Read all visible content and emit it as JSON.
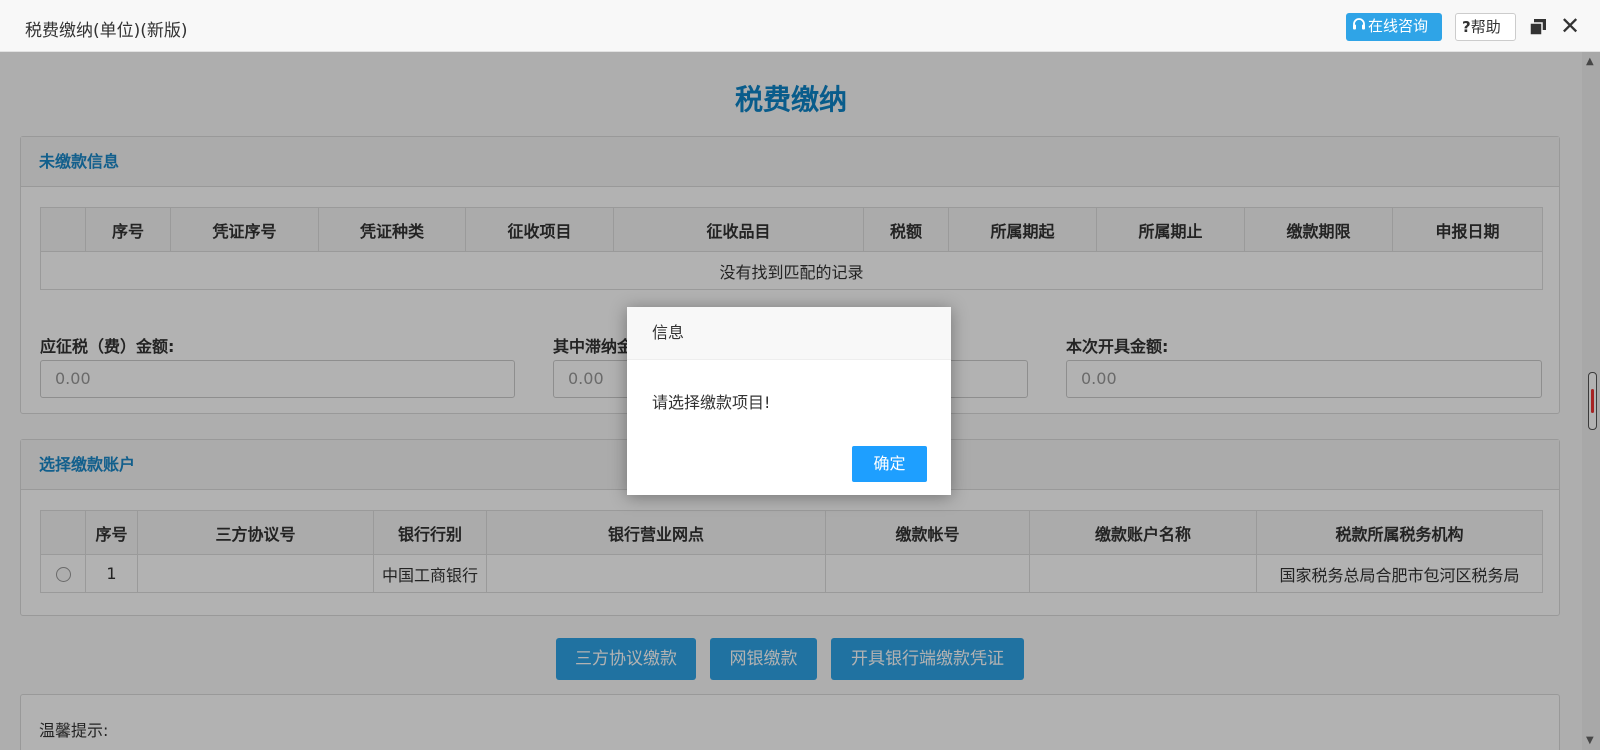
{
  "window": {
    "title": "税费缴纳(单位)(新版)",
    "online_consult": "在线咨询",
    "help": "帮助"
  },
  "page": {
    "title": "税费缴纳"
  },
  "unpaid": {
    "header": "未缴款信息",
    "columns": [
      "序号",
      "凭证序号",
      "凭证种类",
      "征收项目",
      "征收品目",
      "税额",
      "所属期起",
      "所属期止",
      "缴款期限",
      "申报日期"
    ],
    "empty_text": "没有找到匹配的记录"
  },
  "amounts": {
    "due_label": "应征税（费）金额:",
    "due_value": "0.00",
    "late_label": "其中滞纳金",
    "late_value": "0.00",
    "invoice_label": "本次开具金额:",
    "invoice_value": "0.00"
  },
  "account": {
    "header": "选择缴款账户",
    "columns": [
      "序号",
      "三方协议号",
      "银行行别",
      "银行营业网点",
      "缴款帐号",
      "缴款账户名称",
      "税款所属税务机构"
    ],
    "rows": [
      {
        "no": "1",
        "bank": "中国工商银行",
        "tax_office": "国家税务总局合肥市包河区税务局"
      }
    ]
  },
  "actions": {
    "tripartite": "三方协议缴款",
    "online_bank": "网银缴款",
    "bank_voucher": "开具银行端缴款凭证"
  },
  "tips": {
    "label": "温馨提示:"
  },
  "dialog": {
    "title": "信息",
    "message": "请选择缴款项目!",
    "ok": "确定"
  },
  "colors": {
    "accent": "#2fa4e7",
    "title_blue": "#0d84c7",
    "dialog_btn": "#1e9fff"
  }
}
